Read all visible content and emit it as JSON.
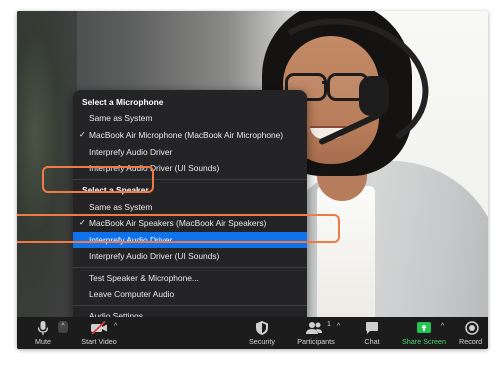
{
  "menu": {
    "microphone_heading": "Select a Microphone",
    "microphones": [
      {
        "label": "Same as System",
        "checked": false
      },
      {
        "label": "MacBook Air Microphone (MacBook Air Microphone)",
        "checked": true
      },
      {
        "label": "Interprefy Audio Driver",
        "checked": false
      },
      {
        "label": "Interprefy Audio Driver (UI Sounds)",
        "checked": false
      }
    ],
    "speaker_heading": "Select a Speaker",
    "speakers": [
      {
        "label": "Same as System",
        "checked": false
      },
      {
        "label": "MacBook Air Speakers (MacBook Air Speakers)",
        "checked": true
      },
      {
        "label": "Interprefy Audio Driver",
        "checked": false,
        "highlighted": true
      },
      {
        "label": "Interprefy Audio Driver (UI Sounds)",
        "checked": false
      }
    ],
    "actions": [
      {
        "label": "Test Speaker & Microphone..."
      },
      {
        "label": "Leave Computer Audio"
      }
    ],
    "settings": "Audio Settings...",
    "check_glyph": "✓"
  },
  "toolbar": {
    "mute": "Mute",
    "start_video": "Start Video",
    "security": "Security",
    "participants": "Participants",
    "participants_count": "1",
    "chat": "Chat",
    "share_screen": "Share Screen",
    "record": "Record",
    "caret": "^"
  },
  "colors": {
    "menu_bg": "#242426",
    "selected": "#0e72ed",
    "callout": "#f07a45",
    "share_green": "#4ad46b",
    "video_off_red": "#e23c3c"
  },
  "icons": [
    "microphone-icon",
    "video-off-icon",
    "shield-icon",
    "participants-icon",
    "chat-icon",
    "share-screen-icon",
    "record-icon",
    "chevron-up-icon",
    "checkmark-icon"
  ]
}
